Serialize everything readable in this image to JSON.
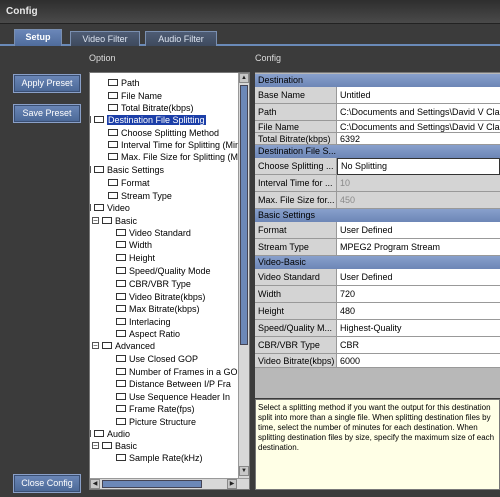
{
  "window": {
    "title": "Config"
  },
  "tabs": [
    "Setup",
    "Video Filter",
    "Audio Filter"
  ],
  "headers": {
    "option": "Option",
    "config": "Config"
  },
  "buttons": {
    "apply": "Apply Preset",
    "save": "Save Preset",
    "close": "Close Config"
  },
  "tree": [
    {
      "label": "Path"
    },
    {
      "label": "File Name"
    },
    {
      "label": "Total Bitrate(kbps)"
    },
    {
      "label": "Destination File Splitting",
      "expander": "-",
      "selected": true
    },
    {
      "label": "Choose Splitting Method"
    },
    {
      "label": "Interval Time for Splitting (Mins"
    },
    {
      "label": "Max. File Size for Splitting (MB)"
    },
    {
      "label": "Basic Settings",
      "expander": "-"
    },
    {
      "label": "Format"
    },
    {
      "label": "Stream Type"
    },
    {
      "label": "Video",
      "expander": "-"
    },
    {
      "label": "Basic",
      "expander": "-"
    },
    {
      "label": "Video Standard"
    },
    {
      "label": "Width"
    },
    {
      "label": "Height"
    },
    {
      "label": "Speed/Quality Mode"
    },
    {
      "label": "CBR/VBR Type"
    },
    {
      "label": "Video Bitrate(kbps)"
    },
    {
      "label": "Max Bitrate(kbps)"
    },
    {
      "label": "Interlacing"
    },
    {
      "label": "Aspect Ratio"
    },
    {
      "label": "Advanced",
      "expander": "-"
    },
    {
      "label": "Use Closed GOP"
    },
    {
      "label": "Number of Frames in a GO"
    },
    {
      "label": "Distance Between I/P Fra"
    },
    {
      "label": "Use Sequence Header In"
    },
    {
      "label": "Frame Rate(fps)"
    },
    {
      "label": "Picture Structure"
    },
    {
      "label": "Audio",
      "expander": "-"
    },
    {
      "label": "Basic",
      "expander": "-"
    },
    {
      "label": "Sample Rate(kHz)"
    }
  ],
  "props": [
    {
      "cat": "Destination"
    },
    {
      "label": "Base Name",
      "value": "Untitled"
    },
    {
      "label": "Path",
      "value": "C:\\Documents and Settings\\David V Clark"
    },
    {
      "label": "File Name",
      "value": "C:\\Documents and Settings\\David V Clark"
    },
    {
      "label": "Total Bitrate(kbps)",
      "value": "6392"
    },
    {
      "cat": "Destination File S..."
    },
    {
      "label": "Choose Splitting ...",
      "value": "No Splitting",
      "combo": true
    },
    {
      "label": "Interval Time for ...",
      "value": "10",
      "disabled": true
    },
    {
      "label": "Max. File Size for...",
      "value": "450",
      "disabled": true
    },
    {
      "cat": "Basic Settings"
    },
    {
      "label": "Format",
      "value": "User Defined"
    },
    {
      "label": "Stream Type",
      "value": "MPEG2 Program Stream"
    },
    {
      "cat": "Video-Basic"
    },
    {
      "label": "Video Standard",
      "value": "User Defined"
    },
    {
      "label": "Width",
      "value": "720"
    },
    {
      "label": "Height",
      "value": "480"
    },
    {
      "label": "Speed/Quality M...",
      "value": "Highest-Quality"
    },
    {
      "label": "CBR/VBR Type",
      "value": "CBR"
    },
    {
      "label": "Video Bitrate(kbps)",
      "value": "6000"
    }
  ],
  "description": "Select a splitting method if you want the output for this destination split into more than a single file. When splitting destination files by time, select the number of minutes for each destination. When splitting destination files by size, specify the maximum size of each destination."
}
